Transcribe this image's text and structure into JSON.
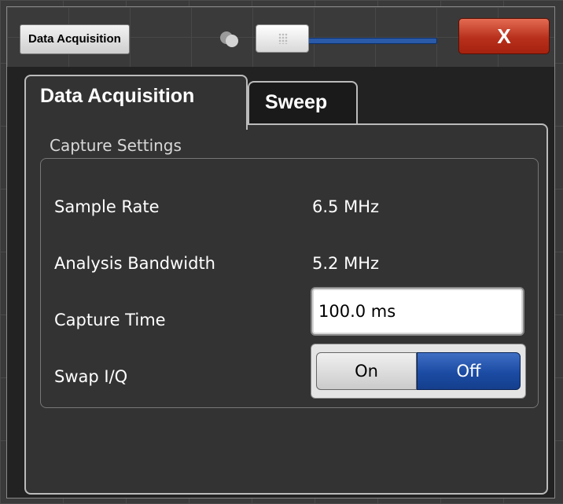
{
  "window": {
    "title": "Data Acquisition",
    "close_label": "X"
  },
  "tabs": [
    {
      "label": "Data Acquisition",
      "active": true
    },
    {
      "label": "Sweep",
      "active": false
    }
  ],
  "capture_settings": {
    "group_title": "Capture Settings",
    "sample_rate": {
      "label": "Sample Rate",
      "value": "6.5 MHz"
    },
    "analysis_bandwidth": {
      "label": "Analysis Bandwidth",
      "value": "5.2 MHz"
    },
    "capture_time": {
      "label": "Capture Time",
      "value": "100.0 ms"
    },
    "swap_iq": {
      "label": "Swap I/Q",
      "on_label": "On",
      "off_label": "Off",
      "selected": "Off"
    }
  },
  "colors": {
    "accent_blue": "#1b4ba3",
    "close_red": "#b8301c",
    "panel_bg": "#333333"
  },
  "icons": {
    "dock": "dock-toggle-icon",
    "close": "close-icon",
    "slider_grip": "grip-icon"
  }
}
